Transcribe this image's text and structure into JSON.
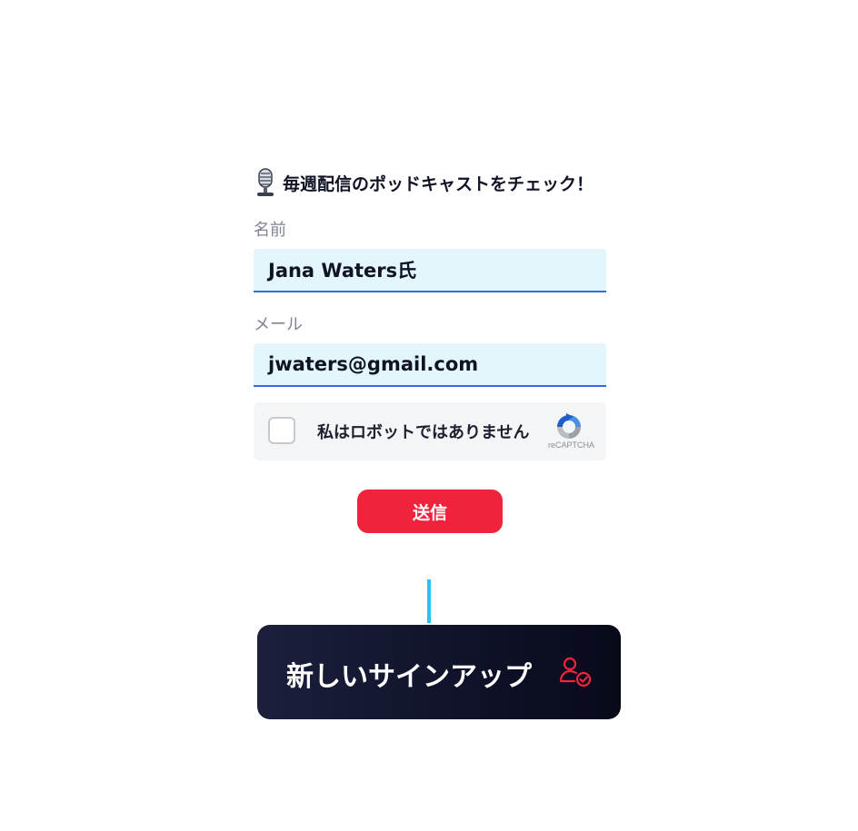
{
  "form": {
    "heading": "毎週配信のポッドキャストをチェック！",
    "heading_icon": "microphone-icon",
    "name_label": "名前",
    "name_value": "Jana Waters氏",
    "email_label": "メール",
    "email_value": "jwaters@gmail.com",
    "captcha": {
      "text": "私はロボットではありません",
      "brand": "reCAPTCHA",
      "logo_icon": "recaptcha-icon"
    },
    "submit_label": "送信"
  },
  "notification": {
    "title": "新しいサインアップ",
    "icon": "user-check-icon"
  },
  "colors": {
    "accent": "#ef233c",
    "connector": "#27c2f2",
    "input_bg": "#e2f6fc",
    "input_border": "#2f6fe0",
    "card_bg": "#10132b"
  }
}
